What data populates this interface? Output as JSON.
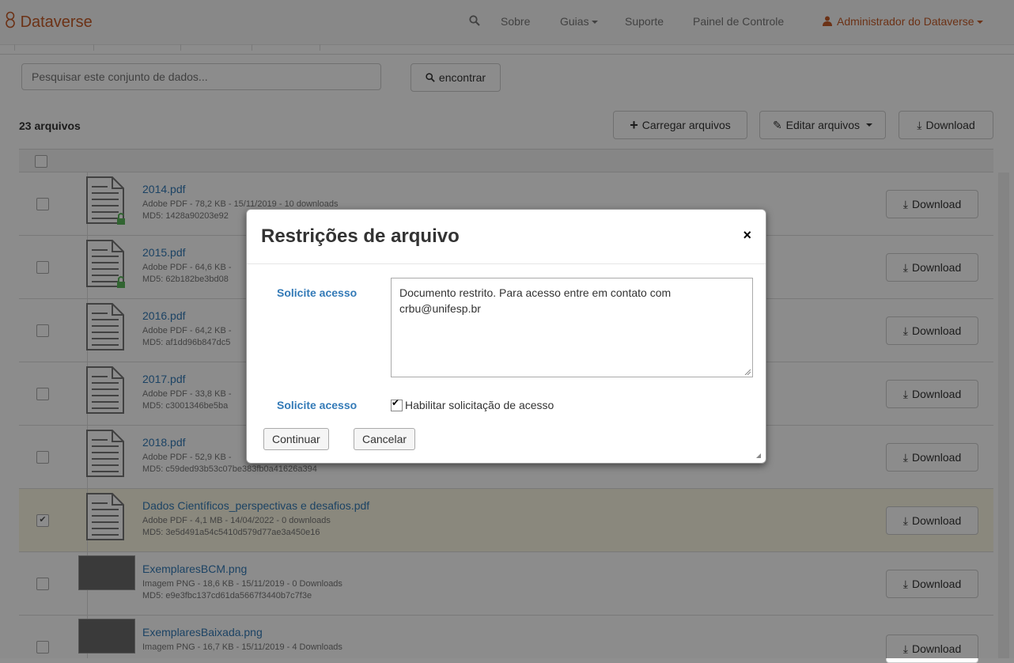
{
  "navbar": {
    "brand": "Dataverse",
    "items": [
      "Sobre",
      "Guias",
      "Suporte",
      "Painel de Controle"
    ],
    "user": "Administrador do Dataverse"
  },
  "search": {
    "placeholder": "Pesquisar este conjunto de dados...",
    "button": "encontrar"
  },
  "files": {
    "count": "23 arquivos",
    "upload": "Carregar arquivos",
    "edit": "Editar arquivos",
    "download_all": "Download",
    "download_label": "Download",
    "rows": [
      {
        "name": "2014.pdf",
        "meta": "Adobe PDF - 78,2 KB - 15/11/2019 - 10 downloads",
        "md5": "MD5: 1428a90203e92",
        "selected": false
      },
      {
        "name": "2015.pdf",
        "meta": "Adobe PDF - 64,6 KB -",
        "md5": "MD5: 62b182be3bd08",
        "selected": false
      },
      {
        "name": "2016.pdf",
        "meta": "Adobe PDF - 64,2 KB -",
        "md5": "MD5: af1dd96b847dc5",
        "selected": false
      },
      {
        "name": "2017.pdf",
        "meta": "Adobe PDF - 33,8 KB -",
        "md5": "MD5: c3001346be5ba",
        "selected": false
      },
      {
        "name": "2018.pdf",
        "meta": "Adobe PDF - 52,9 KB -",
        "md5": "MD5: c59ded93b53c07be383fb0a41626a394",
        "selected": false
      },
      {
        "name": "Dados Científicos_perspectivas e desafios.pdf",
        "meta": "Adobe PDF - 4,1 MB - 14/04/2022 - 0 downloads",
        "md5": "MD5: 3e5d491a54c5410d579d77ae3a450e16",
        "selected": true
      },
      {
        "name": "ExemplaresBCM.png",
        "meta": "Imagem PNG - 18,6 KB - 15/11/2019 - 0 Downloads",
        "md5": "MD5: e9e3fbc137cd61da5667f3440b7c7f3e",
        "selected": false
      },
      {
        "name": "ExemplaresBaixada.png",
        "meta": "Imagem PNG - 16,7 KB - 15/11/2019 - 4 Downloads",
        "md5": "",
        "selected": false
      }
    ]
  },
  "modal": {
    "title": "Restrições de arquivo",
    "close": "×",
    "label1": "Solicite acesso",
    "textarea_value": "Documento restrito. Para acesso entre em contato com crbu@unifesp.br",
    "label2": "Solicite acesso",
    "checkbox_label": "Habilitar solicitação de acesso",
    "continue": "Continuar",
    "cancel": "Cancelar"
  }
}
